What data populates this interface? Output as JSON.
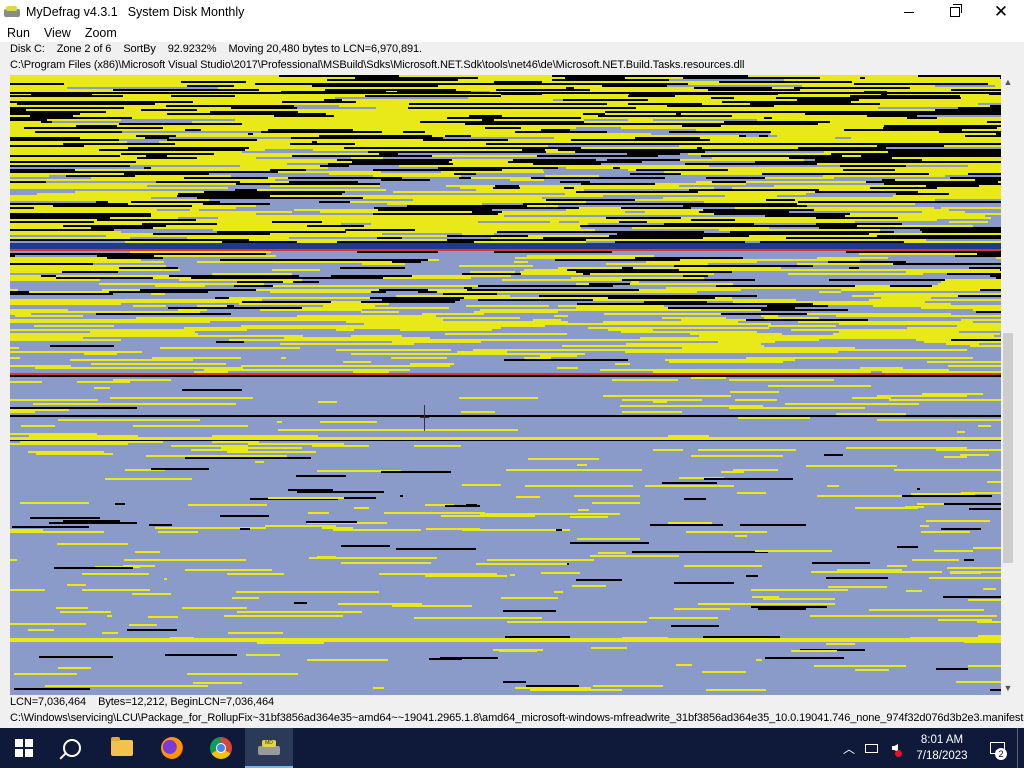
{
  "window": {
    "app_title": "MyDefrag v4.3.1",
    "script_name": "System Disk Monthly"
  },
  "menu": [
    "Run",
    "View",
    "Zoom"
  ],
  "status": {
    "disk": "Disk C:",
    "zone": "Zone 2 of 6",
    "sortby": "SortBy",
    "percent": "92.9232%",
    "action": "Moving 20,480 bytes to LCN=6,970,891.",
    "current_file": "C:\\Program Files (x86)\\Microsoft Visual Studio\\2017\\Professional\\MSBuild\\Sdks\\Microsoft.NET.Sdk\\tools\\net46\\de\\Microsoft.NET.Build.Tasks.resources.dll",
    "lcn": "LCN=7,036,464",
    "bytes_info": "Bytes=12,212, BeginLCN=7,036,464",
    "hover_file": "C:\\Windows\\servicing\\LCU\\Package_for_RollupFix~31bf3856ad364e35~amd64~~19041.2965.1.8\\amd64_microsoft-windows-mfreadwrite_31bf3856ad364e35_10.0.19041.746_none_974f32d076d3b2e3.manifest"
  },
  "disk_colors": {
    "free": "#8a9bc9",
    "unfragmented": "#e9e91a",
    "spacehog": "#000000",
    "fragmented": "#d8362e",
    "unmovable": "#1f3a8a"
  },
  "taskbar": {
    "apps": [
      "start-icon",
      "search-icon",
      "file-explorer-icon",
      "firefox-icon",
      "chrome-icon",
      "mydefrag-icon"
    ],
    "time": "8:01 AM",
    "date": "7/18/2023",
    "notification_count": "2"
  }
}
